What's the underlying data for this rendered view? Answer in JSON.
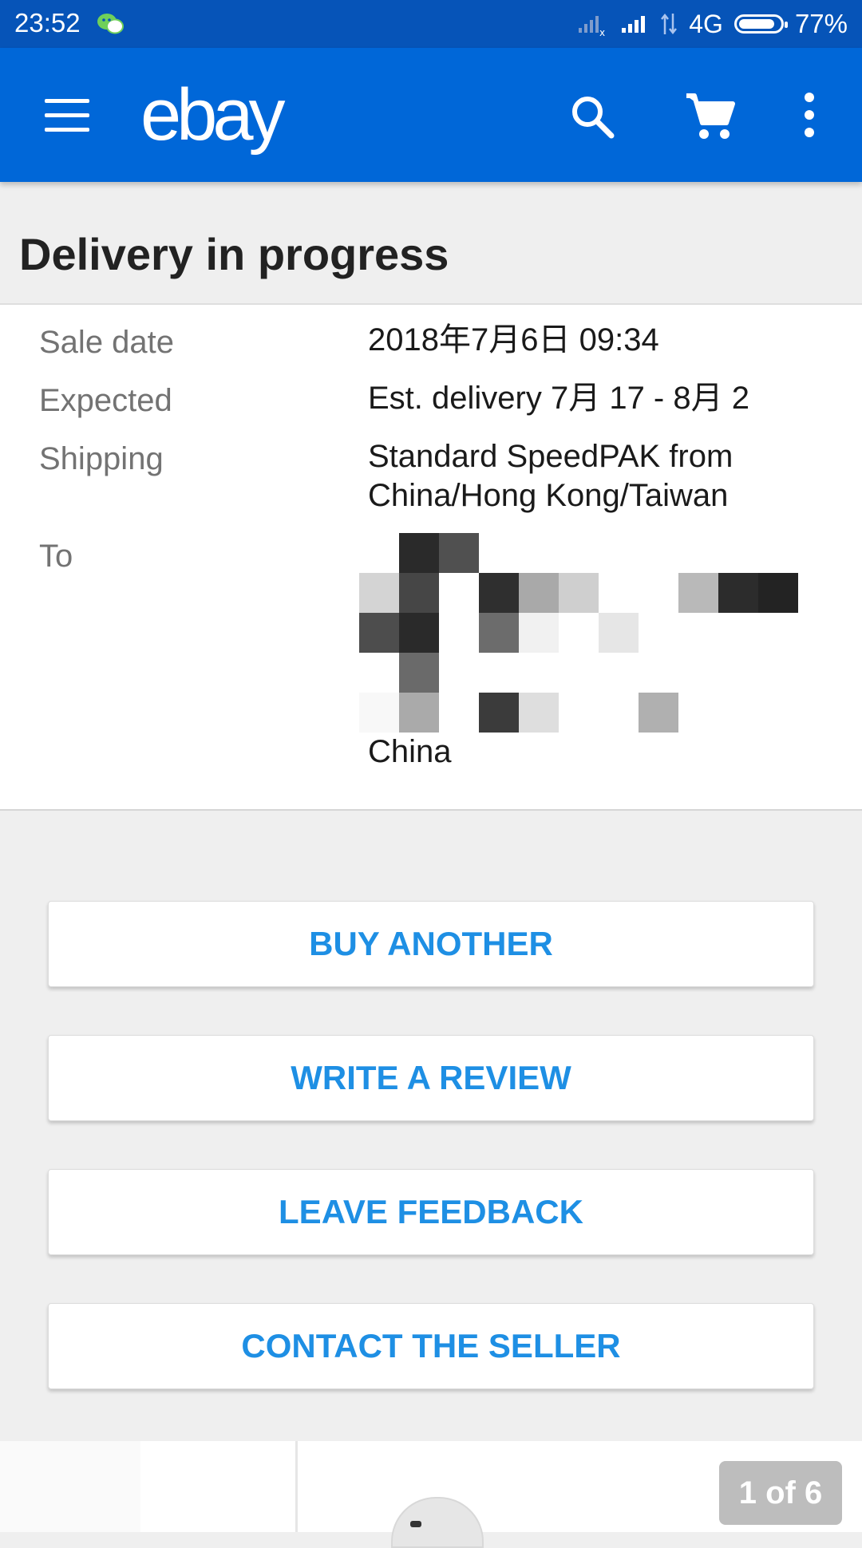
{
  "status_bar": {
    "time": "23:52",
    "network": "4G",
    "battery": "77%",
    "battery_level": 0.77,
    "icons": [
      "wechat-icon",
      "signal-x-icon",
      "signal-icon",
      "data-arrows-icon",
      "battery-icon"
    ]
  },
  "app_bar": {
    "logo": "ebay",
    "icons": [
      "menu-icon",
      "search-icon",
      "cart-icon",
      "more-vert-icon"
    ],
    "background": "#0067d8"
  },
  "page": {
    "title": "Delivery in progress"
  },
  "details": {
    "rows": [
      {
        "label": "Sale date",
        "value": "2018年7月6日 09:34"
      },
      {
        "label": "Expected",
        "value": "Est. delivery 7月 17 - 8月 2"
      },
      {
        "label": "Shipping",
        "value_line1": "Standard SpeedPAK from",
        "value_line2": "China/Hong Kong/Taiwan"
      },
      {
        "label": "To",
        "value": "China"
      }
    ]
  },
  "actions": [
    {
      "label": "BUY ANOTHER"
    },
    {
      "label": "WRITE A REVIEW"
    },
    {
      "label": "LEAVE FEEDBACK"
    },
    {
      "label": "CONTACT THE SELLER"
    }
  ],
  "gallery": {
    "counter": "1 of 6"
  },
  "colors": {
    "status_bar": "#0654b8",
    "accent": "#1e8fe4",
    "background": "#efefef"
  }
}
